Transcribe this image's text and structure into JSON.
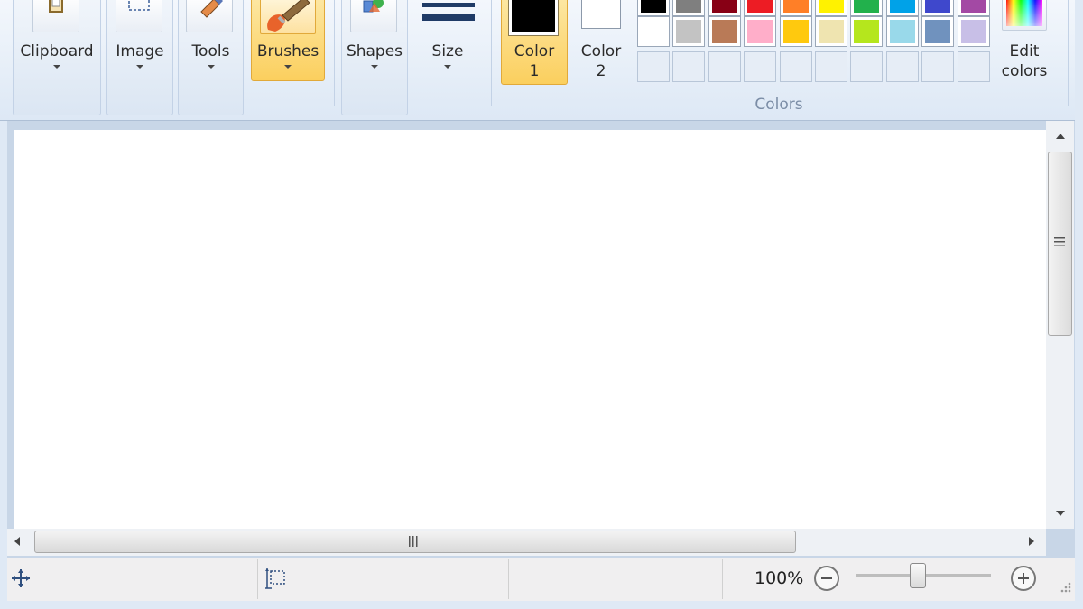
{
  "ribbon": {
    "clipboard": "Clipboard",
    "image": "Image",
    "tools": "Tools",
    "brushes": "Brushes",
    "shapes": "Shapes",
    "size": "Size",
    "color1_line1": "Color",
    "color1_line2": "1",
    "color2_line1": "Color",
    "color2_line2": "2",
    "edit_colors_line1": "Edit",
    "edit_colors_line2": "colors",
    "colors_group": "Colors"
  },
  "palette": {
    "row1": [
      "#000000",
      "#7f7f7f",
      "#880015",
      "#ed1c24",
      "#ff7f27",
      "#fff200",
      "#22b14c",
      "#00a2e8",
      "#3f48cc",
      "#a349a4"
    ],
    "row2": [
      "#ffffff",
      "#c3c3c3",
      "#b97a57",
      "#ffaec9",
      "#ffc90e",
      "#efe4b0",
      "#b5e61d",
      "#99d9ea",
      "#7092be",
      "#c8bfe7"
    ],
    "color1": "#000000",
    "color2": "#ffffff"
  },
  "status": {
    "zoom": "100%",
    "zoom_level": 0.5
  }
}
